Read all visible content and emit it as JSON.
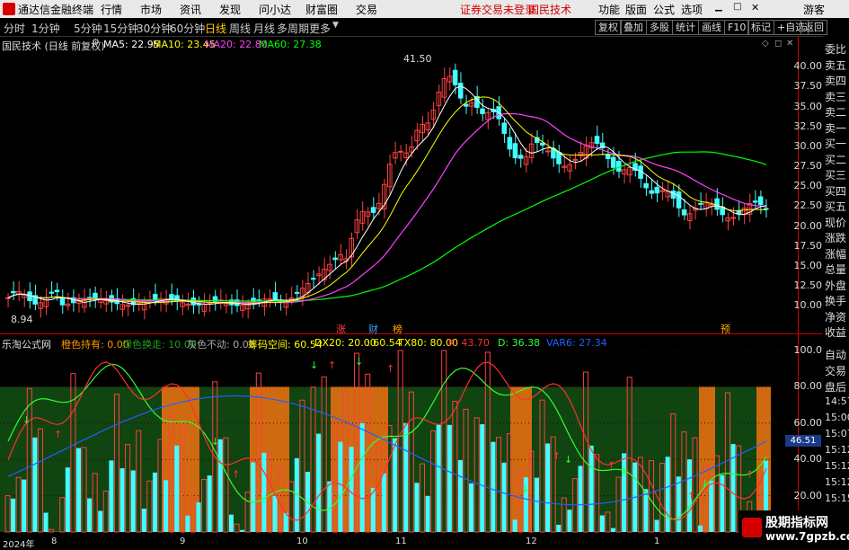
{
  "app": {
    "title": "通达信金融终端",
    "warning": "证券交易未登录",
    "broker": "国民技术",
    "guest": "游客"
  },
  "menu": [
    "行情",
    "市场",
    "资讯",
    "发现",
    "问小达",
    "财富圈",
    "交易"
  ],
  "right_menu": [
    "功能",
    "版面",
    "公式",
    "选项"
  ],
  "periods": [
    "分时",
    "1分钟",
    "5分钟",
    "15分钟",
    "30分钟",
    "60分钟",
    "日线",
    "周线",
    "月线",
    "多周期",
    "更多"
  ],
  "active_period": "日线",
  "toolbar_buttons": [
    "复权",
    "叠加",
    "多股",
    "统计",
    "画线",
    "F10",
    "标记",
    "+自选",
    "返回"
  ],
  "main_info": {
    "stock": "国民技术 (日线 前复权)",
    "ma5": "MA5: 22.95",
    "ma10": "MA10: 23.45",
    "ma20": "MA20: 22.80",
    "ma60": "MA60: 27.38",
    "high_label": "41.50",
    "low_label": "8.94",
    "events": [
      "涨",
      "财",
      "榜",
      "预"
    ]
  },
  "main_axis": [
    "40.00",
    "37.50",
    "35.00",
    "32.50",
    "30.00",
    "27.50",
    "25.00",
    "22.50",
    "20.00",
    "17.50",
    "15.00",
    "12.50",
    "10.00"
  ],
  "sub_info": {
    "name": "乐淘公式网",
    "items": [
      "橙色持有: 0.00",
      "绿色换走: 10.00",
      "灰色不动: 0.00",
      "筹码空间: 60.54",
      "DX20: 20.00",
      ": 60.54",
      "TX80: 80.00",
      "K: 43.70",
      "D: 36.38",
      "VAR6: 27.34"
    ],
    "current": "46.51"
  },
  "sub_axis": [
    "100.0",
    "80.00",
    "60.00",
    "40.00",
    "20.00"
  ],
  "side_top": [
    "委比",
    "卖五",
    "卖四",
    "卖三",
    "卖二",
    "卖一",
    "买一",
    "买二",
    "买三",
    "买四",
    "买五",
    "现价",
    "涨跌",
    "涨幅",
    "总量",
    "外盘",
    "换手",
    "净资",
    "收益"
  ],
  "side_bottom": [
    "自动",
    "交易",
    "盘后",
    "14:57",
    "15:00",
    "15:07",
    "15:12",
    "15:12",
    "15:12",
    "15:15",
    "15:15"
  ],
  "dates": [
    "2024年",
    "8",
    "9",
    "10",
    "11",
    "12",
    "1"
  ],
  "watermark": {
    "line1": "股期指标网",
    "line2": "www.7gpzb.com"
  },
  "colors": {
    "up": "#ff4040",
    "down": "#40ffff",
    "ma5": "#ffffff",
    "ma10": "#ffff00",
    "ma20": "#ff40ff",
    "ma60": "#00ff00",
    "green_bg": "#104410",
    "orange_bg": "#d06a10"
  }
}
